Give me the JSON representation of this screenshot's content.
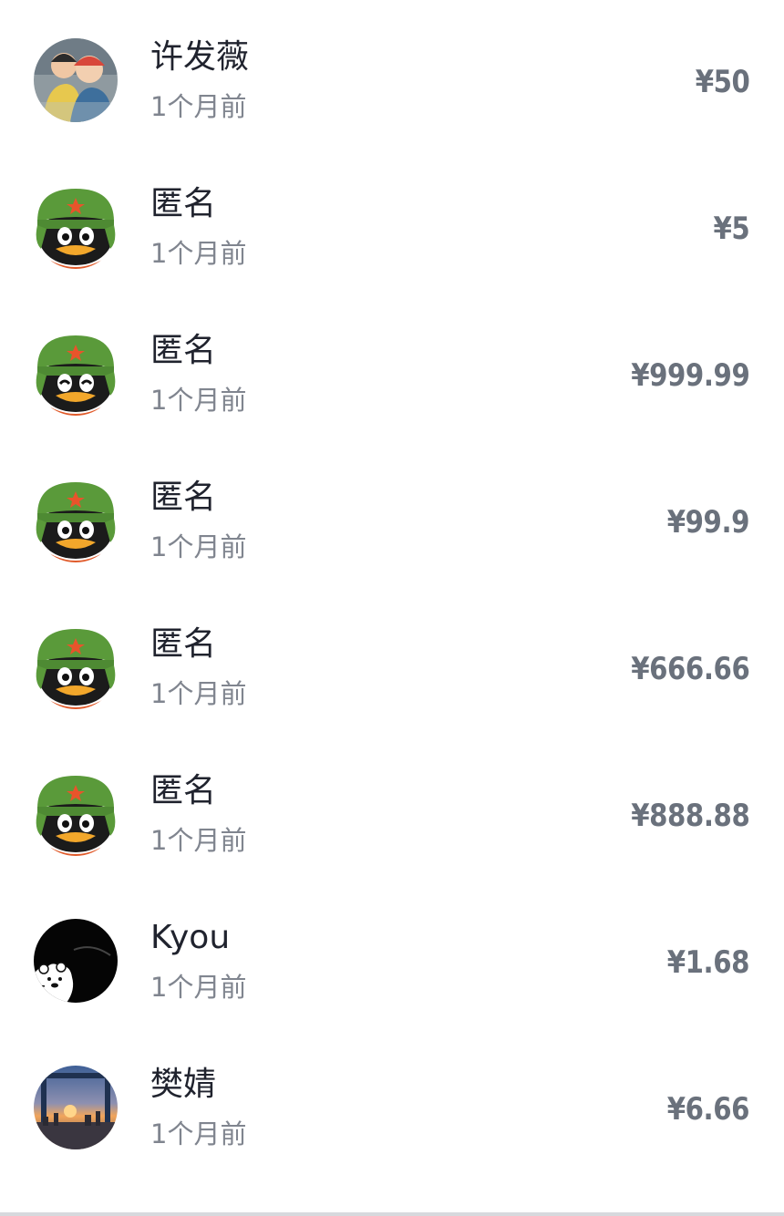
{
  "donations": [
    {
      "name": "许发薇",
      "time": "1个月前",
      "amount": "¥50",
      "avatar": "photo-kids"
    },
    {
      "name": "匿名",
      "time": "1个月前",
      "amount": "¥5",
      "avatar": "qq-penguin"
    },
    {
      "name": "匿名",
      "time": "1个月前",
      "amount": "¥999.99",
      "avatar": "qq-penguin"
    },
    {
      "name": "匿名",
      "time": "1个月前",
      "amount": "¥99.9",
      "avatar": "qq-penguin"
    },
    {
      "name": "匿名",
      "time": "1个月前",
      "amount": "¥666.66",
      "avatar": "qq-penguin"
    },
    {
      "name": "匿名",
      "time": "1个月前",
      "amount": "¥888.88",
      "avatar": "qq-penguin"
    },
    {
      "name": "Kyou",
      "time": "1个月前",
      "amount": "¥1.68",
      "avatar": "cartoon-bear"
    },
    {
      "name": "樊婧",
      "time": "1个月前",
      "amount": "¥6.66",
      "avatar": "photo-sunset-city"
    }
  ],
  "colors": {
    "name_text": "#20232e",
    "time_text": "#80858f",
    "amount_text": "#6a717c",
    "divider": "#d7d9dd"
  }
}
